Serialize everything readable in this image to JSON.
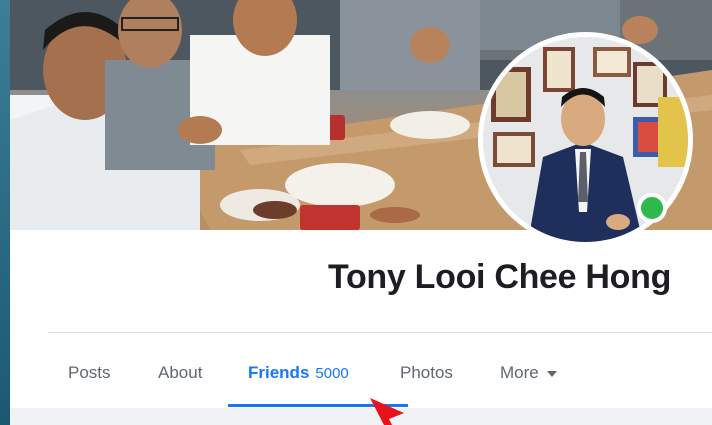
{
  "profile": {
    "name": "Tony Looi Chee Hong"
  },
  "tabs": [
    {
      "label": "Posts"
    },
    {
      "label": "About"
    },
    {
      "label": "Friends",
      "count": "5000"
    },
    {
      "label": "Photos"
    },
    {
      "label": "More"
    }
  ],
  "colors": {
    "accent": "#1877f2",
    "online": "#2fb84b",
    "annotation_arrow": "#e8121b"
  }
}
